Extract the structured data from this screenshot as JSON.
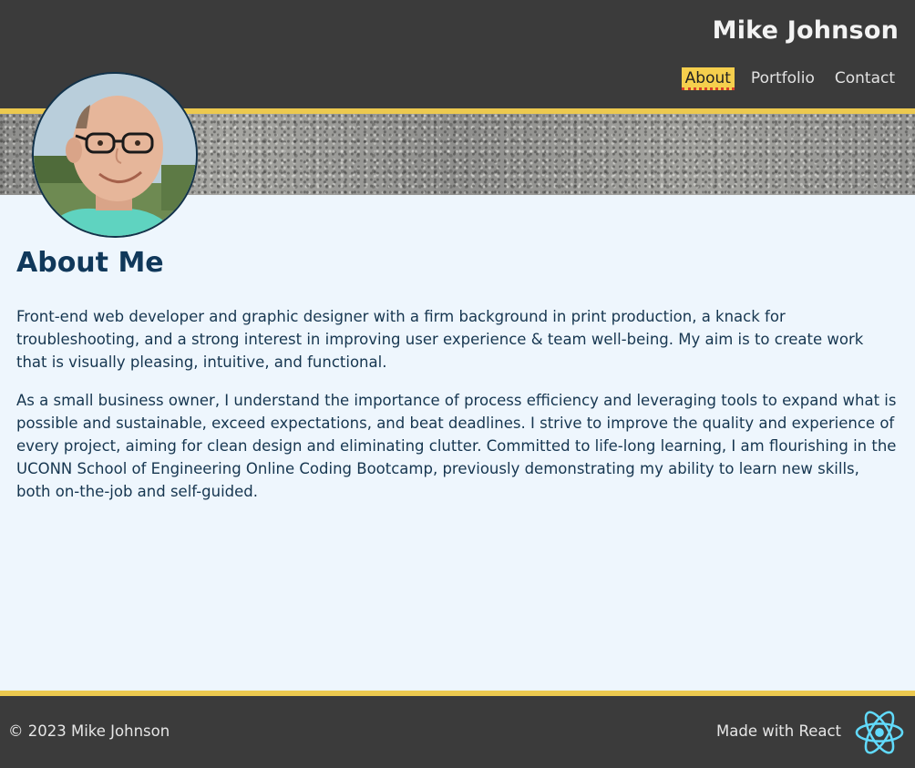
{
  "header": {
    "title": "Mike Johnson",
    "nav": [
      {
        "label": "About",
        "active": true
      },
      {
        "label": "Portfolio",
        "active": false
      },
      {
        "label": "Contact",
        "active": false
      }
    ]
  },
  "main": {
    "heading": "About Me",
    "paragraphs": [
      "Front-end web developer and graphic designer with a firm background in print production, a knack for troubleshooting, and a strong interest in improving user experience & team well-being. My aim is to create work that is visually pleasing, intuitive, and functional.",
      "As a small business owner, I understand the importance of process efficiency and leveraging tools to expand what is possible and sustainable, exceed expectations, and beat deadlines. I strive to improve the quality and experience of every project, aiming for clean design and eliminating clutter. Committed to life-long learning, I am flourishing in the UCONN School of Engineering Online Coding Bootcamp, previously demonstrating my ability to learn new skills, both on-the-job and self-guided."
    ]
  },
  "footer": {
    "copyright": "© 2023 Mike Johnson",
    "made_with": "Made with React",
    "icon": "react-logo-icon"
  },
  "colors": {
    "header_bg": "#3b3b3b",
    "accent_yellow": "#ecc94f",
    "page_bg": "#eef6fd",
    "heading": "#10385a",
    "react_blue": "#61dafb"
  }
}
